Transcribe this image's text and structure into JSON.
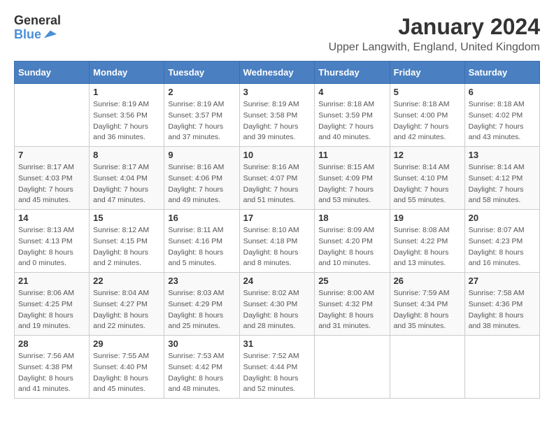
{
  "header": {
    "logo_general": "General",
    "logo_blue": "Blue",
    "title": "January 2024",
    "location": "Upper Langwith, England, United Kingdom"
  },
  "calendar": {
    "days_of_week": [
      "Sunday",
      "Monday",
      "Tuesday",
      "Wednesday",
      "Thursday",
      "Friday",
      "Saturday"
    ],
    "weeks": [
      [
        {
          "day": "",
          "info": ""
        },
        {
          "day": "1",
          "info": "Sunrise: 8:19 AM\nSunset: 3:56 PM\nDaylight: 7 hours\nand 36 minutes."
        },
        {
          "day": "2",
          "info": "Sunrise: 8:19 AM\nSunset: 3:57 PM\nDaylight: 7 hours\nand 37 minutes."
        },
        {
          "day": "3",
          "info": "Sunrise: 8:19 AM\nSunset: 3:58 PM\nDaylight: 7 hours\nand 39 minutes."
        },
        {
          "day": "4",
          "info": "Sunrise: 8:18 AM\nSunset: 3:59 PM\nDaylight: 7 hours\nand 40 minutes."
        },
        {
          "day": "5",
          "info": "Sunrise: 8:18 AM\nSunset: 4:00 PM\nDaylight: 7 hours\nand 42 minutes."
        },
        {
          "day": "6",
          "info": "Sunrise: 8:18 AM\nSunset: 4:02 PM\nDaylight: 7 hours\nand 43 minutes."
        }
      ],
      [
        {
          "day": "7",
          "info": "Sunrise: 8:17 AM\nSunset: 4:03 PM\nDaylight: 7 hours\nand 45 minutes."
        },
        {
          "day": "8",
          "info": "Sunrise: 8:17 AM\nSunset: 4:04 PM\nDaylight: 7 hours\nand 47 minutes."
        },
        {
          "day": "9",
          "info": "Sunrise: 8:16 AM\nSunset: 4:06 PM\nDaylight: 7 hours\nand 49 minutes."
        },
        {
          "day": "10",
          "info": "Sunrise: 8:16 AM\nSunset: 4:07 PM\nDaylight: 7 hours\nand 51 minutes."
        },
        {
          "day": "11",
          "info": "Sunrise: 8:15 AM\nSunset: 4:09 PM\nDaylight: 7 hours\nand 53 minutes."
        },
        {
          "day": "12",
          "info": "Sunrise: 8:14 AM\nSunset: 4:10 PM\nDaylight: 7 hours\nand 55 minutes."
        },
        {
          "day": "13",
          "info": "Sunrise: 8:14 AM\nSunset: 4:12 PM\nDaylight: 7 hours\nand 58 minutes."
        }
      ],
      [
        {
          "day": "14",
          "info": "Sunrise: 8:13 AM\nSunset: 4:13 PM\nDaylight: 8 hours\nand 0 minutes."
        },
        {
          "day": "15",
          "info": "Sunrise: 8:12 AM\nSunset: 4:15 PM\nDaylight: 8 hours\nand 2 minutes."
        },
        {
          "day": "16",
          "info": "Sunrise: 8:11 AM\nSunset: 4:16 PM\nDaylight: 8 hours\nand 5 minutes."
        },
        {
          "day": "17",
          "info": "Sunrise: 8:10 AM\nSunset: 4:18 PM\nDaylight: 8 hours\nand 8 minutes."
        },
        {
          "day": "18",
          "info": "Sunrise: 8:09 AM\nSunset: 4:20 PM\nDaylight: 8 hours\nand 10 minutes."
        },
        {
          "day": "19",
          "info": "Sunrise: 8:08 AM\nSunset: 4:22 PM\nDaylight: 8 hours\nand 13 minutes."
        },
        {
          "day": "20",
          "info": "Sunrise: 8:07 AM\nSunset: 4:23 PM\nDaylight: 8 hours\nand 16 minutes."
        }
      ],
      [
        {
          "day": "21",
          "info": "Sunrise: 8:06 AM\nSunset: 4:25 PM\nDaylight: 8 hours\nand 19 minutes."
        },
        {
          "day": "22",
          "info": "Sunrise: 8:04 AM\nSunset: 4:27 PM\nDaylight: 8 hours\nand 22 minutes."
        },
        {
          "day": "23",
          "info": "Sunrise: 8:03 AM\nSunset: 4:29 PM\nDaylight: 8 hours\nand 25 minutes."
        },
        {
          "day": "24",
          "info": "Sunrise: 8:02 AM\nSunset: 4:30 PM\nDaylight: 8 hours\nand 28 minutes."
        },
        {
          "day": "25",
          "info": "Sunrise: 8:00 AM\nSunset: 4:32 PM\nDaylight: 8 hours\nand 31 minutes."
        },
        {
          "day": "26",
          "info": "Sunrise: 7:59 AM\nSunset: 4:34 PM\nDaylight: 8 hours\nand 35 minutes."
        },
        {
          "day": "27",
          "info": "Sunrise: 7:58 AM\nSunset: 4:36 PM\nDaylight: 8 hours\nand 38 minutes."
        }
      ],
      [
        {
          "day": "28",
          "info": "Sunrise: 7:56 AM\nSunset: 4:38 PM\nDaylight: 8 hours\nand 41 minutes."
        },
        {
          "day": "29",
          "info": "Sunrise: 7:55 AM\nSunset: 4:40 PM\nDaylight: 8 hours\nand 45 minutes."
        },
        {
          "day": "30",
          "info": "Sunrise: 7:53 AM\nSunset: 4:42 PM\nDaylight: 8 hours\nand 48 minutes."
        },
        {
          "day": "31",
          "info": "Sunrise: 7:52 AM\nSunset: 4:44 PM\nDaylight: 8 hours\nand 52 minutes."
        },
        {
          "day": "",
          "info": ""
        },
        {
          "day": "",
          "info": ""
        },
        {
          "day": "",
          "info": ""
        }
      ]
    ]
  }
}
